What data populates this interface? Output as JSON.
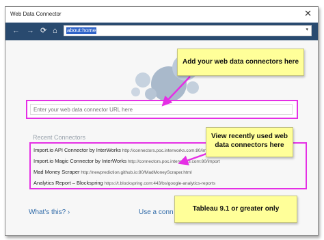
{
  "window": {
    "title": "Web Data Connector",
    "close_glyph": "✕"
  },
  "toolbar": {
    "back_glyph": "←",
    "forward_glyph": "→",
    "refresh_glyph": "⟳",
    "home_glyph": "⌂",
    "address": "about:home",
    "dropdown_glyph": "▾"
  },
  "main": {
    "url_placeholder": "Enter your web data connector URL here",
    "recent_title": "Recent Connectors",
    "recent": [
      {
        "name": "Import.io API Connector by InterWorks",
        "url": "http://connectors.poc.interworks.com:80/import"
      },
      {
        "name": "Import.io Magic Connector by InterWorks",
        "url": "http://connectors.poc.interworks.com:80/import"
      },
      {
        "name": "Mad Money Scraper",
        "url": "http://newprediction.github.io:80/MadMoneyScraper.html"
      },
      {
        "name": "Analytics Report – Blockspring",
        "url": "https://t.blockspring.com:443/bs/google-analytics-reports"
      }
    ],
    "whats_this": "What's this? ›",
    "use_connector": "Use a conn"
  },
  "callouts": {
    "add": "Add your web data connectors here",
    "recent": "View recently used web data connectors here",
    "version": "Tableau 9.1 or greater only"
  },
  "colors": {
    "toolbar": "#294a6f",
    "highlight": "#e52fe5",
    "callout": "#ffff99",
    "link": "#2f6aa8"
  }
}
